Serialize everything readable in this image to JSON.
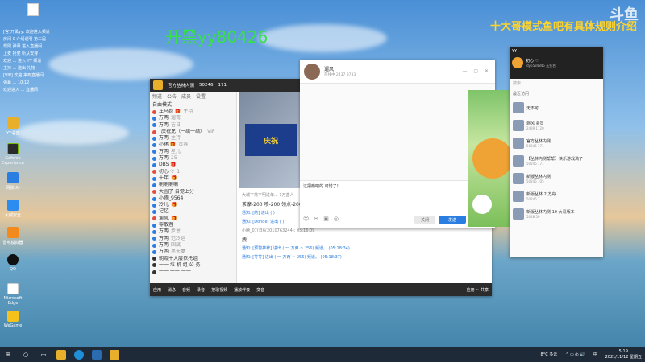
{
  "overlay": {
    "left_text": "开黑yy80426",
    "right_text": "十大哥模式鱼吧有具体规则介绍",
    "logo": "斗鱼"
  },
  "desktop_icons": [
    {
      "label": "YY语音",
      "icon": "yy-icon",
      "color": "#e8b02a"
    },
    {
      "label": "Geforce Experience",
      "icon": "geforce-icon",
      "color": "#2b2b2b"
    },
    {
      "label": "网易UU",
      "icon": "uu-icon",
      "color": "#2a7de1"
    },
    {
      "label": "火绒安全",
      "icon": "shield-icon",
      "color": "#2d8cf0"
    },
    {
      "label": "雷电模拟器",
      "icon": "emulator-icon",
      "color": "#f28a1e"
    },
    {
      "label": "QQ",
      "icon": "qq-icon",
      "color": "#111111"
    },
    {
      "label": "Microsoft Edge",
      "icon": "edge-icon",
      "color": "#1e8fd6"
    },
    {
      "label": "WeGame",
      "icon": "wegame-icon",
      "color": "#f4c21a"
    }
  ],
  "desktop_log": [
    "[官]开黑yy: 欢迎进入频道",
    "房间 0 介绍说明 第二届",
    "规则 弹幕 进入直播间",
    "上麦 抢麦 听从安排",
    "欢迎 ... 进入 YY 频道",
    "主持 ... 送出 礼物",
    "[VIP] 欢迎 来到直播间",
    "弹幕 ... 10:12",
    "欢迎进入 ... 直播间"
  ],
  "yy_main": {
    "title": "官方丛林内测",
    "channel_id": "50246",
    "online": "171",
    "mode_label": "自由模式",
    "tabs": [
      "频道",
      "公告",
      "成员",
      "设置"
    ],
    "members": [
      {
        "name": "车马炮 🎁",
        "role": "主持",
        "color": "#e74c3c"
      },
      {
        "name": "万两",
        "role": "遛弯",
        "color": "#2a7de1"
      },
      {
        "name": "万两",
        "role": "吉日",
        "color": "#2a7de1"
      },
      {
        "name": "_庆祝兄（一结一结）",
        "role": "VIP",
        "color": "#e74c3c"
      },
      {
        "name": "万两",
        "role": "主持",
        "color": "#2a7de1"
      },
      {
        "name": "小猪 🎁",
        "role": "贵宾",
        "color": "#2a7de1"
      },
      {
        "name": "万两",
        "role": "星儿",
        "color": "#2a7de1"
      },
      {
        "name": "万两",
        "role": "25",
        "color": "#2a7de1"
      },
      {
        "name": "DBS 🎁",
        "role": "",
        "color": "#2a7de1"
      },
      {
        "name": "初心 ♡",
        "role": "1",
        "color": "#e74c3c"
      },
      {
        "name": "十年",
        "role": "🎁",
        "color": "#2a7de1"
      },
      {
        "name": "喇喇喇喇",
        "role": "",
        "color": "#2a7de1"
      },
      {
        "name": "大圆子 自觉上分",
        "role": "",
        "color": "#e74c3c"
      },
      {
        "name": "小腾_9564",
        "role": "",
        "color": "#2a7de1"
      },
      {
        "name": "冷儿",
        "role": "🎁",
        "color": "#2a7de1"
      },
      {
        "name": "记忆",
        "role": "",
        "color": "#2a7de1"
      },
      {
        "name": "遛风",
        "role": "🎁",
        "color": "#e74c3c"
      },
      {
        "name": "零散者",
        "role": "",
        "color": "#2a7de1"
      },
      {
        "name": "万两",
        "role": "步恩",
        "color": "#2a7de1"
      },
      {
        "name": "万两",
        "role": "范冷运",
        "color": "#2a7de1"
      },
      {
        "name": "万两",
        "role": "国斌",
        "color": "#2a7de1"
      },
      {
        "name": "万两",
        "role": "黑夫妻",
        "color": "#2a7de1"
      },
      {
        "name": "朝霞十大层依托姐",
        "role": "",
        "color": "#333333"
      },
      {
        "name": "一一 垃 机 组 公 务",
        "role": "",
        "color": "#333333"
      },
      {
        "name": "一一 一一 一一",
        "role": "",
        "color": "#333333"
      }
    ],
    "chat": [
      {
        "text": "大城下落不明过年... 1万蓝人",
        "color": "#888888"
      },
      {
        "text": "茶摩-200 喷-200 领点-200",
        "color": "#333333"
      },
      {
        "text": "通知: [的] 进出 (          )",
        "color": "#2a7de1"
      },
      {
        "text": "通知: [Donde] 进出 (          )",
        "color": "#2a7de1"
      },
      {
        "text": "小腾_07(日6(2010763244): 05:16:09",
        "color": "#888888"
      },
      {
        "text": "拽",
        "color": "#333333"
      },
      {
        "text": "通知: [预警推荐] 进出 ( 一 万两 ~ 256) 频道。 (05:18:34)",
        "color": "#2a7de1"
      },
      {
        "text": "通知: [等等] 进出 ( 一 万两 ~ 256) 频道。 (05:18:37)",
        "color": "#2a7de1"
      }
    ],
    "toolbar": [
      "应用",
      "消息",
      "音频",
      "录音",
      "按歌视频",
      "播放伴奏",
      "变音"
    ],
    "footer_right": "应用 ~ 共享"
  },
  "chat_window": {
    "name": "遛风",
    "status": "在线中 2437 3733",
    "input_text": "过把瘾吧的   可惜了！",
    "close_btn": "关闭",
    "send_btn": "发送",
    "toolbar_icons": [
      "emoji-icon",
      "cut-icon",
      "image-icon",
      "shake-icon"
    ]
  },
  "yy_side": {
    "title": "YY",
    "user": "初心 ♡",
    "user_id": "idy6534845 无签名",
    "search_placeholder": "搜索",
    "section": "最近访问",
    "items": [
      {
        "name": "无不可",
        "sub": ""
      },
      {
        "name": "遛风 会员",
        "sub": "2439 1720"
      },
      {
        "name": "官方丛林内测",
        "sub": "50246  171"
      },
      {
        "name": "【丛林内测帮帮】快乐游戏满了",
        "sub": "50246  171"
      },
      {
        "name": "新版丛林内测",
        "sub": "50246  105"
      },
      {
        "name": "新版丛林 2 方舟",
        "sub": "50246  7"
      },
      {
        "name": "新版丛林内测 10 大哥版本",
        "sub": "5048  50"
      }
    ]
  },
  "taskbar": {
    "temp": "8°C 多云",
    "time": "5:19",
    "date": "2021/11/12 星期五",
    "lang": "中"
  }
}
